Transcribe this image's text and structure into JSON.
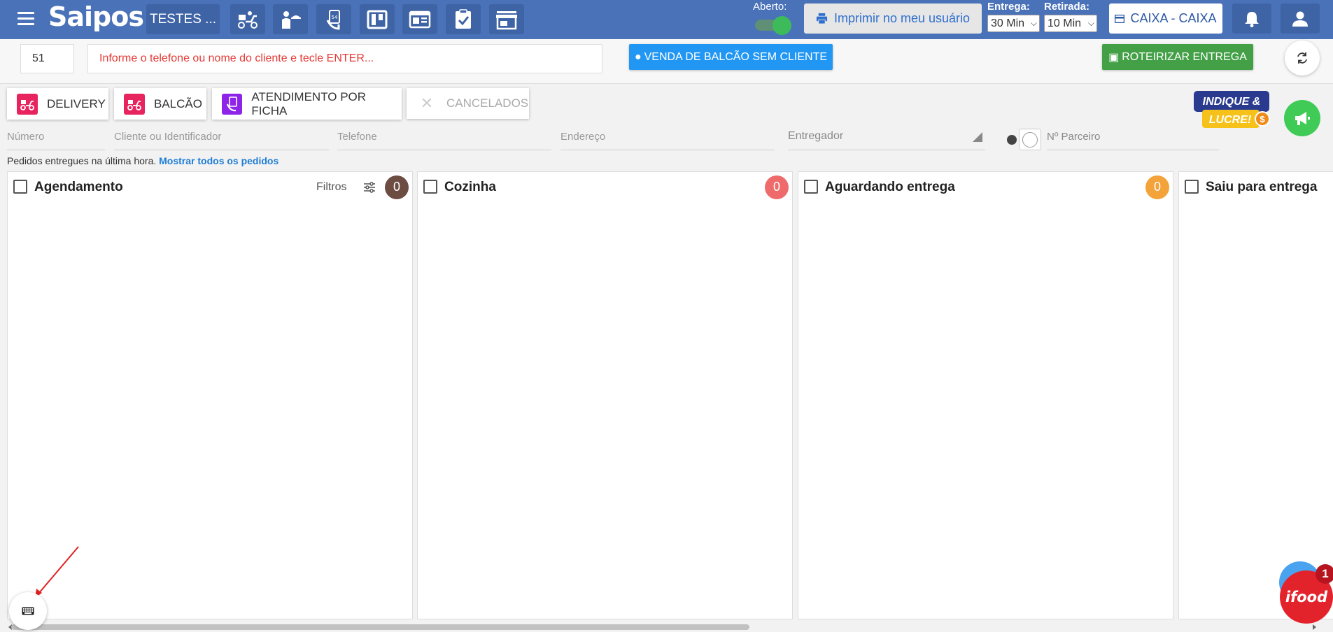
{
  "topbar": {
    "brand": "Saipos",
    "store_name": "TESTES ...",
    "nav_icons": [
      "delivery-scooter-icon",
      "waiter-icon",
      "ticket-card-icon",
      "kanban-board-icon",
      "table-layout-icon",
      "clipboard-check-icon",
      "storefront-icon"
    ],
    "open_label": "Aberto:",
    "open_state": true,
    "print_label": "Imprimir no meu usuário",
    "delivery_label": "Entrega:",
    "delivery_value": "30 Min",
    "pickup_label": "Retirada:",
    "pickup_value": "10 Min",
    "cashier_label": "CAIXA - CAIXA"
  },
  "search": {
    "number_value": "51",
    "client_placeholder": "Informe o telefone ou nome do cliente e tecle ENTER...",
    "counter_sale_label": "VENDA DE BALCÃO SEM CLIENTE",
    "route_label": "ROTEIRIZAR ENTREGA"
  },
  "tabs": [
    {
      "label": "DELIVERY",
      "icon": "delivery-icon"
    },
    {
      "label": "BALCÃO",
      "icon": "counter-icon"
    },
    {
      "label": "ATENDIMENTO POR FICHA",
      "icon": "ticket-icon"
    },
    {
      "label": "CANCELADOS",
      "icon": "close-icon"
    }
  ],
  "promo": {
    "line1": "INDIQUE &",
    "line2": "LUCRE!"
  },
  "filters": {
    "number": "Número",
    "client": "Cliente ou Identificador",
    "phone": "Telefone",
    "address": "Endereço",
    "courier": "Entregador",
    "partner": "Nº Parceiro"
  },
  "hint": {
    "text": "Pedidos entregues na última hora.",
    "link": "Mostrar todos os pedidos"
  },
  "columns": [
    {
      "title": "Agendamento",
      "count": "0",
      "color": "#6d4c41",
      "filters_label": "Filtros"
    },
    {
      "title": "Cozinha",
      "count": "0",
      "color": "#ef6b6b"
    },
    {
      "title": "Aguardando entrega",
      "count": "0",
      "color": "#f3a33a"
    },
    {
      "title": "Saiu para entrega"
    }
  ],
  "ifood": {
    "label": "ifood",
    "badge": "1"
  },
  "colors": {
    "topbar": "#4a72b8",
    "primary": "#2196f3",
    "success": "#43a047",
    "danger": "#e53935"
  }
}
